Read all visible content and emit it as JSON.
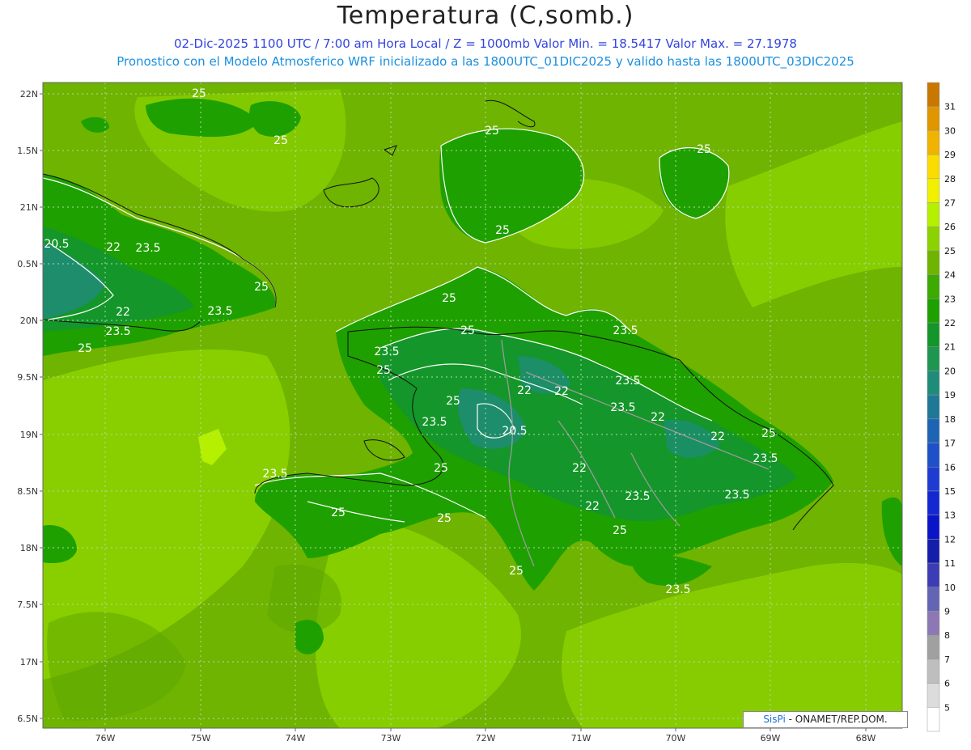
{
  "header": {
    "title": "Temperatura (C,somb.)",
    "line1": "02-Dic-2025  1100 UTC / 7:00 am Hora Local / Z = 1000mb   Valor Min. = 18.5417  Valor Max. = 27.1978",
    "line2": "Pronostico con el Modelo Atmosferico WRF inicializado a las 1800UTC_01DIC2025 y valido hasta las  1800UTC_03DIC2025"
  },
  "axes": {
    "lat_labels": [
      "22N",
      "1.5N",
      "21N",
      "0.5N",
      "20N",
      "9.5N",
      "19N",
      "8.5N",
      "18N",
      "7.5N",
      "17N",
      "6.5N"
    ],
    "lon_labels": [
      "76W",
      "75W",
      "74W",
      "73W",
      "72W",
      "71W",
      "70W",
      "69W",
      "68W"
    ]
  },
  "colorbar": {
    "labels": [
      "31",
      "30",
      "29",
      "28",
      "27",
      "26",
      "25",
      "24",
      "23",
      "22",
      "21",
      "20",
      "19",
      "18",
      "17",
      "16",
      "15",
      "13",
      "12",
      "11",
      "10",
      "9",
      "8",
      "7",
      "6",
      "5"
    ],
    "colors": [
      "#c87800",
      "#e09600",
      "#f0b400",
      "#fadc00",
      "#f0f000",
      "#b4f000",
      "#8cd200",
      "#6eb400",
      "#3caa00",
      "#1ea000",
      "#14962a",
      "#1e9650",
      "#1e8c78",
      "#1e7896",
      "#1e64b4",
      "#1e50c8",
      "#1e3cd2",
      "#1428d2",
      "#0a14c8",
      "#141eaa",
      "#3c3cb4",
      "#6464b4",
      "#8c78b4",
      "#a0a0a0",
      "#bebebe",
      "#dcdcdc",
      "#ffffff"
    ]
  },
  "contour_labels": [
    "25",
    "25",
    "25",
    "25",
    "25",
    "20.5",
    "22",
    "23.5",
    "25",
    "22",
    "23.5",
    "23.5",
    "25",
    "25",
    "25",
    "23.5",
    "23.5",
    "25",
    "25",
    "22",
    "23.5",
    "23.5",
    "22",
    "23.5",
    "22",
    "20.5",
    "25",
    "22",
    "22",
    "23.5",
    "23.5",
    "25",
    "25",
    "25",
    "23.5",
    "23.5",
    "25",
    "25",
    "22",
    "23.5",
    "25"
  ],
  "credit": {
    "brand": "SisPi",
    "text": " - ONAMET/REP.DOM."
  }
}
